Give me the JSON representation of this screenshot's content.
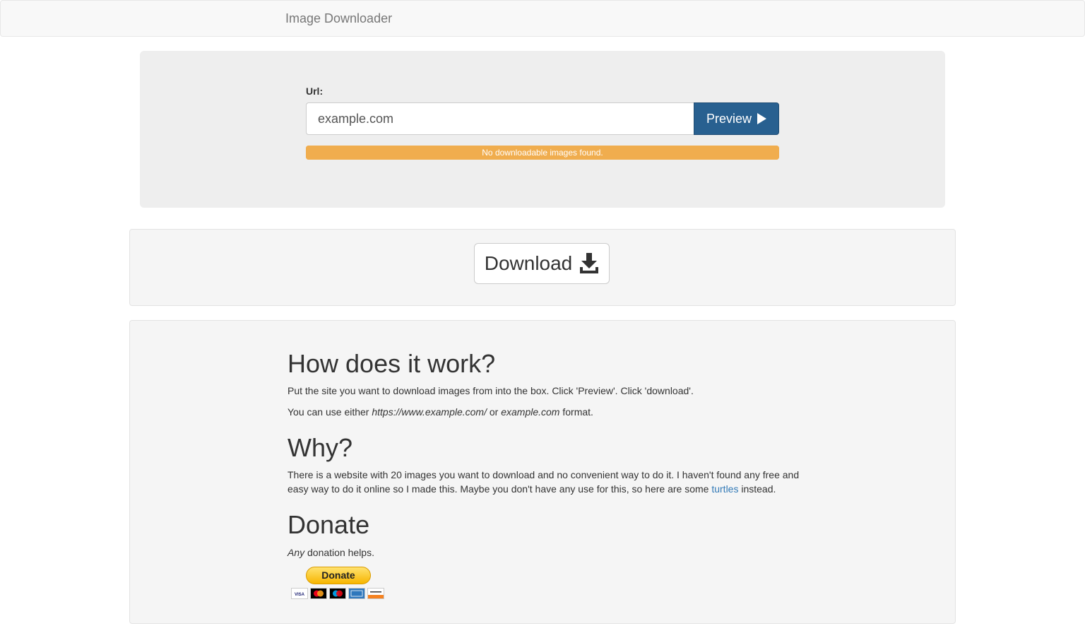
{
  "navbar": {
    "brand": "Image Downloader"
  },
  "form": {
    "url_label": "Url:",
    "url_value": "example.com",
    "preview_label": "Preview",
    "status_text": "No downloadable images found.",
    "status_progress": 1.0
  },
  "download": {
    "label": "Download"
  },
  "info": {
    "how_title": "How does it work?",
    "how_p1": "Put the site you want to download images from into the box. Click 'Preview'. Click 'download'.",
    "how_p2_prefix": "You can use either ",
    "how_p2_url1": "https://www.example.com/",
    "how_p2_mid": " or ",
    "how_p2_url2": "example.com",
    "how_p2_suffix": " format.",
    "why_title": "Why?",
    "why_text": "There is a website with 20 images you want to download and no convenient way to do it. I haven't found any free and easy way to do it online so I made this. Maybe you don't have any use for this, so here are some ",
    "why_link": "turtles",
    "why_suffix": " instead.",
    "donate_title": "Donate",
    "donate_em": "Any",
    "donate_text": " donation helps.",
    "donate_button": "Donate",
    "cards": [
      "VISA",
      "MC",
      "MAESTRO",
      "AMEX",
      "DISCOVER"
    ]
  },
  "colors": {
    "primary": "#286090",
    "warning": "#f0ad4e",
    "link": "#337ab7"
  }
}
